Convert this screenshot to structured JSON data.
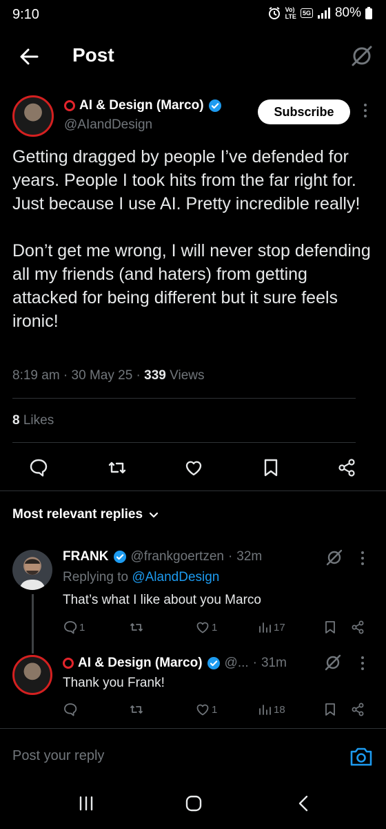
{
  "status_bar": {
    "time": "9:10",
    "network_top": "Vo)",
    "network_bottom": "LTE",
    "gen": "5G",
    "battery": "80%"
  },
  "header": {
    "title": "Post"
  },
  "post": {
    "author_name": "AI & Design (Marco)",
    "author_handle": "@AIandDesign",
    "subscribe_label": "Subscribe",
    "text": "Getting dragged by people I’ve defended for years. People I took hits from the far right for. Just because I use AI. Pretty incredible really!\n\nDon’t get me wrong, I will never stop defending all my friends (and haters) from getting attacked for being different but it sure feels ironic!",
    "time": "8:19 am",
    "date": "30 May 25",
    "views_count": "339",
    "views_label": "Views",
    "likes_count": "8",
    "likes_label": "Likes"
  },
  "replies_section": {
    "sort_label": "Most relevant replies"
  },
  "replies": [
    {
      "name": "FRANK",
      "handle": "@frankgoertzen",
      "time": "32m",
      "replying_prefix": "Replying to",
      "replying_handle": "@AlandDesign",
      "text": "That’s what I like about you Marco",
      "replies": "1",
      "retweets": "",
      "likes": "1",
      "views": "17"
    },
    {
      "name": "AI & Design (Marco)",
      "handle": "@...",
      "time": "31m",
      "text": "Thank you Frank!",
      "replies": "",
      "retweets": "",
      "likes": "1",
      "views": "18"
    }
  ],
  "composer": {
    "placeholder": "Post your reply"
  },
  "colors": {
    "accent": "#1d9bf0",
    "avatar_ring": "#d42020",
    "muted": "#71767b"
  }
}
